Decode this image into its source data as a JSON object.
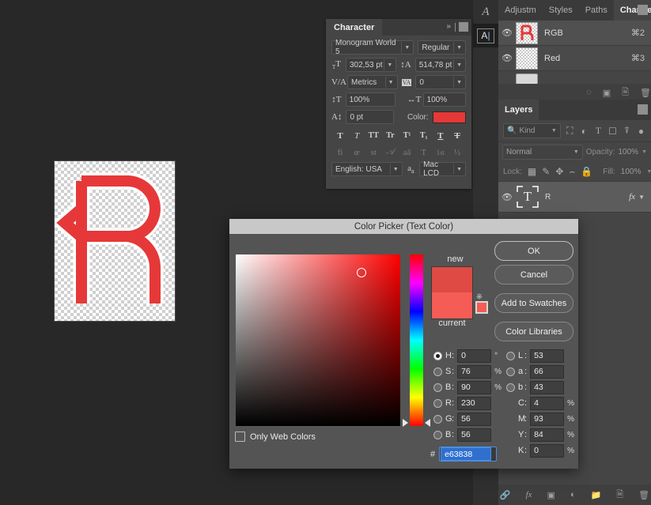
{
  "app": {
    "background_color": "#282828",
    "panel_color": "#454545",
    "accent_color": "#e63838"
  },
  "canvas": {
    "artwork_label": "letter-r-monogram",
    "letter": "R",
    "letter_color": "#e63838"
  },
  "tools": {
    "calligraphy_label": "A",
    "text_tool_label": "A"
  },
  "channels_panel": {
    "tabs": [
      {
        "label": "Adjustm",
        "active": false
      },
      {
        "label": "Styles",
        "active": false
      },
      {
        "label": "Paths",
        "active": false
      },
      {
        "label": "Channels",
        "active": true
      }
    ],
    "rows": [
      {
        "name": "RGB",
        "shortcut": "⌘2"
      },
      {
        "name": "Red",
        "shortcut": "⌘3"
      }
    ],
    "footer_icons": [
      "load-selection-icon",
      "save-selection-icon",
      "new-channel-icon",
      "delete-channel-icon"
    ]
  },
  "layers_panel": {
    "tab_label": "Layers",
    "filter": {
      "kind_label": "Kind",
      "icons": [
        "pixel-filter-icon",
        "adjustment-filter-icon",
        "type-filter-icon",
        "shape-filter-icon",
        "smart-object-filter-icon"
      ]
    },
    "blend": {
      "mode": "Normal",
      "opacity_label": "Opacity:",
      "opacity_value": "100%"
    },
    "lock": {
      "label": "Lock:",
      "fill_label": "Fill:",
      "fill_value": "100%",
      "icons": [
        "lock-transparency-icon",
        "lock-image-icon",
        "lock-position-icon",
        "lock-artboard-icon",
        "lock-all-icon"
      ]
    },
    "rows": [
      {
        "name": "R",
        "thumb": "T",
        "fx": "fx"
      }
    ],
    "footer_icons": [
      "link-layers-icon",
      "layer-style-icon",
      "layer-mask-icon",
      "adjustment-layer-icon",
      "new-group-icon",
      "new-layer-icon",
      "delete-layer-icon"
    ]
  },
  "character_panel": {
    "tab_label": "Character",
    "collapse_icon": "double-chevron-right-icon",
    "font_family": "Monogram World 5",
    "font_style": "Regular",
    "font_size": "302,53 pt",
    "leading": "514,78 pt",
    "kerning": "Metrics",
    "tracking": "0",
    "vertical_scale": "100%",
    "horizontal_scale": "100%",
    "baseline_shift": "0 pt",
    "color_label": "Color:",
    "color_value": "#e63838",
    "style_buttons": [
      "T",
      "T",
      "TT",
      "Tr",
      "T¹",
      "T₁",
      "T",
      "T"
    ],
    "opentype_buttons": [
      "fi",
      "œ",
      "st",
      "𝒜",
      "aā",
      "T",
      "1st",
      "½"
    ],
    "language": "English: USA",
    "antialias_icon": "a-a-icon",
    "antialias_method": "Mac LCD"
  },
  "color_picker": {
    "title": "Color Picker (Text Color)",
    "buttons": {
      "ok": "OK",
      "cancel": "Cancel",
      "add_to_swatches": "Add to Swatches",
      "color_libraries": "Color Libraries"
    },
    "preview": {
      "new_label": "new",
      "current_label": "current",
      "new_color": "#e04a44",
      "current_color": "#f45c55",
      "out_of_gamut_icon": "gamut-warning-icon",
      "web_safe_icon": "web-safe-warning-icon"
    },
    "only_web_colors": {
      "label": "Only Web Colors",
      "checked": false
    },
    "hsb": [
      {
        "key": "H",
        "value": "0",
        "unit": "°",
        "selected": true
      },
      {
        "key": "S",
        "value": "76",
        "unit": "%",
        "selected": false
      },
      {
        "key": "B",
        "value": "90",
        "unit": "%",
        "selected": false
      }
    ],
    "rgb": [
      {
        "key": "R",
        "value": "230",
        "unit": "",
        "selected": false
      },
      {
        "key": "G",
        "value": "56",
        "unit": "",
        "selected": false
      },
      {
        "key": "B",
        "value": "56",
        "unit": "",
        "selected": false
      }
    ],
    "lab": [
      {
        "key": "L",
        "value": "53",
        "unit": "",
        "selected": false
      },
      {
        "key": "a",
        "value": "66",
        "unit": "",
        "selected": false
      },
      {
        "key": "b",
        "value": "43",
        "unit": "",
        "selected": false
      }
    ],
    "cmyk": [
      {
        "key": "C",
        "value": "4",
        "unit": "%"
      },
      {
        "key": "M",
        "value": "93",
        "unit": "%"
      },
      {
        "key": "Y",
        "value": "84",
        "unit": "%"
      },
      {
        "key": "K",
        "value": "0",
        "unit": "%"
      }
    ],
    "hex_symbol": "#",
    "hex_value": "e63838"
  }
}
